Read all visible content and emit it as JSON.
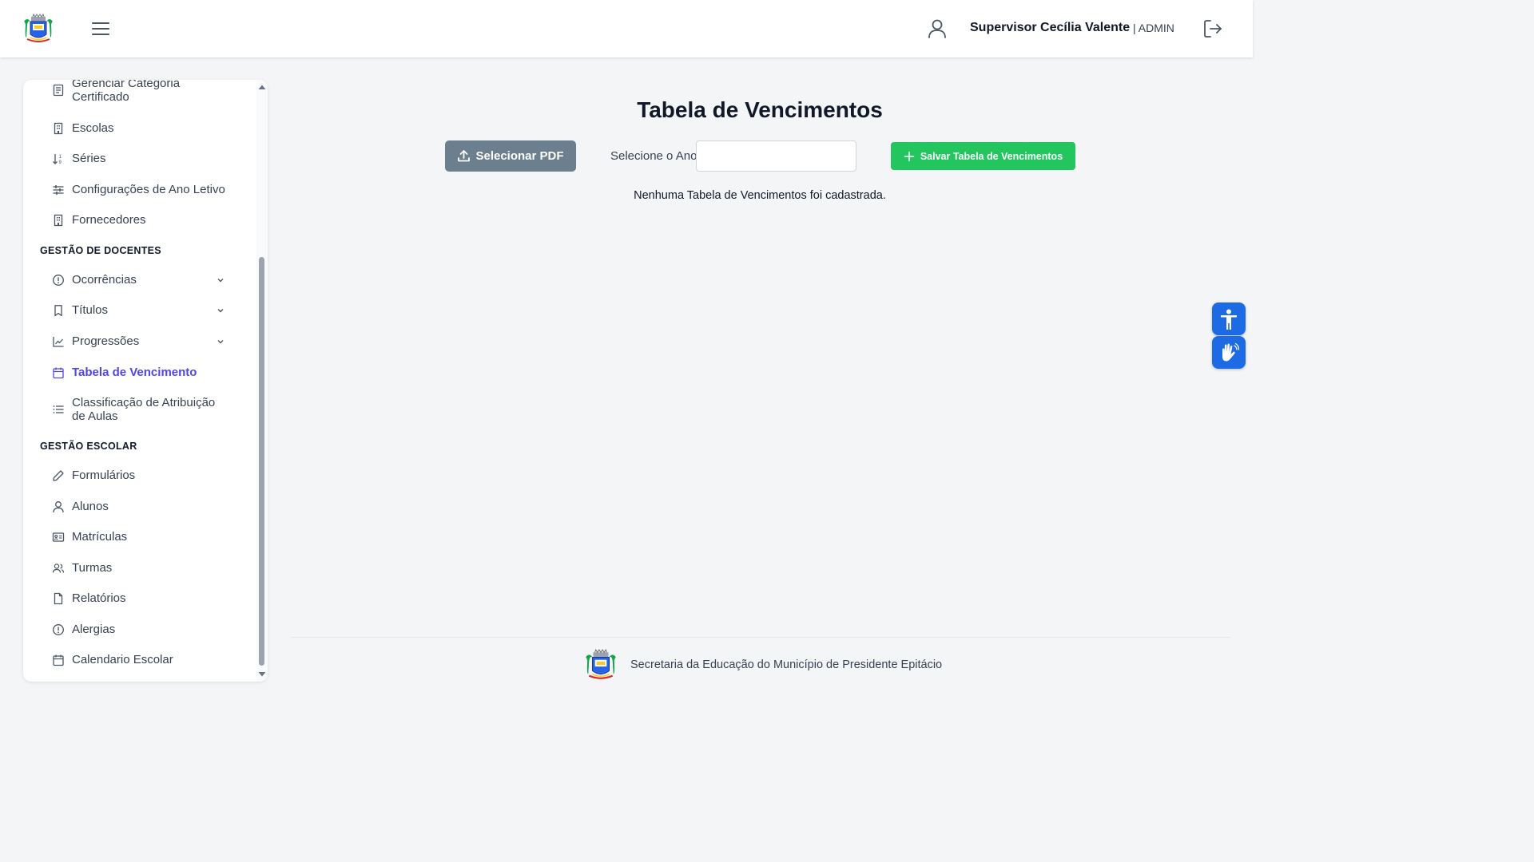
{
  "header": {
    "user_name": "Supervisor Cecília Valente",
    "user_role": "| ADMIN",
    "icons": [
      "brasao-logo",
      "menu-icon",
      "user-icon",
      "logout-icon"
    ]
  },
  "sidebar": {
    "items_top": [
      {
        "label": "Gerenciar Categoria Certificado",
        "icon": "document-icon"
      },
      {
        "label": "Escolas",
        "icon": "building-icon"
      },
      {
        "label": "Séries",
        "icon": "sort-icon"
      },
      {
        "label": "Configurações de Ano Letivo",
        "icon": "sliders-icon"
      },
      {
        "label": "Fornecedores",
        "icon": "building-icon"
      }
    ],
    "section_docentes": "GESTÃO DE DOCENTES",
    "items_docentes": [
      {
        "label": "Ocorrências",
        "icon": "alert-circle-icon"
      },
      {
        "label": "Títulos",
        "icon": "bookmark-icon"
      },
      {
        "label": "Progressões",
        "icon": "chart-line-icon"
      },
      {
        "label": "Tabela de Vencimento",
        "icon": "calendar-icon"
      },
      {
        "label": "Classificação de Atribuição de Aulas",
        "icon": "list-icon"
      }
    ],
    "section_escolar": "GESTÃO ESCOLAR",
    "items_escolar": [
      {
        "label": "Formulários",
        "icon": "pencil-icon"
      },
      {
        "label": "Alunos",
        "icon": "user-icon"
      },
      {
        "label": "Matrículas",
        "icon": "id-card-icon"
      },
      {
        "label": "Turmas",
        "icon": "users-icon"
      },
      {
        "label": "Relatórios",
        "icon": "file-icon"
      },
      {
        "label": "Alergias",
        "icon": "alert-circle-icon"
      },
      {
        "label": "Calendario Escolar",
        "icon": "calendar-icon"
      }
    ],
    "active_item": "Tabela de Vencimento"
  },
  "main": {
    "title": "Tabela de Vencimentos",
    "select_pdf_label": "Selecionar PDF",
    "year_label": "Selecione o Ano:",
    "year_value": "",
    "save_label": "Salvar Tabela de Vencimentos",
    "empty_message": "Nenhuma Tabela de Vencimentos foi cadastrada."
  },
  "footer": {
    "text": "Secretaria da Educação do Município de Presidente Epitácio"
  },
  "accessibility": {
    "icons": [
      "accessibility-icon",
      "sign-language-icon"
    ]
  },
  "colors": {
    "accent_active": "#4f46e5",
    "save_button": "#22c55e",
    "pdf_button": "#6b7f8f",
    "accessibility_button": "#1d6ae5"
  }
}
